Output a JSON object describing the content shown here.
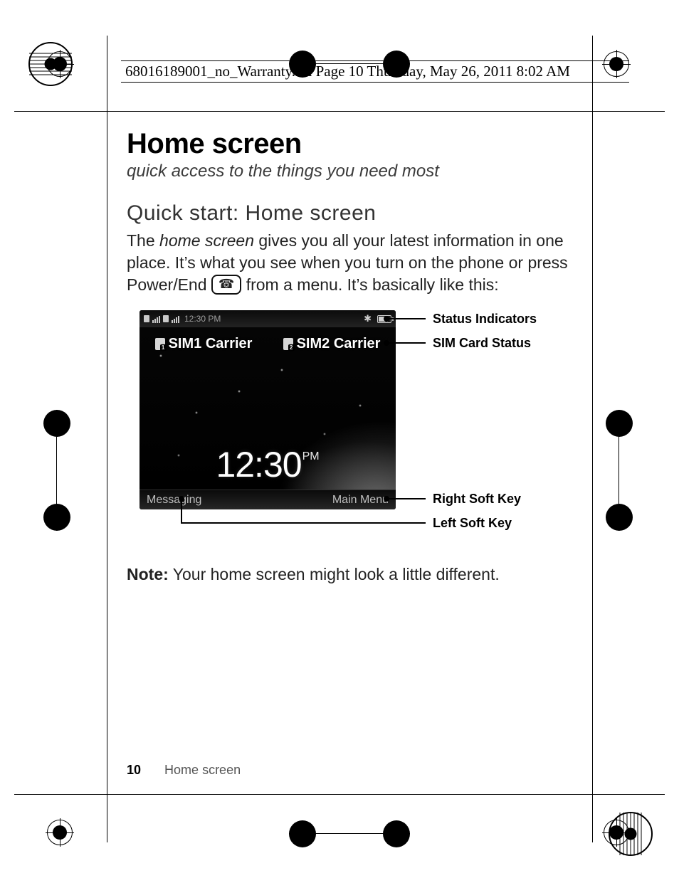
{
  "page_header": "68016189001_no_Warranty.fm  Page 10  Thursday, May 26, 2011  8:02 AM",
  "heading": "Home screen",
  "tagline": "quick access to the things you need most",
  "subheading": "Quick start: Home screen",
  "para1_a": "The ",
  "para1_b": "home screen",
  "para1_c": " gives you all your latest information in one place. It’s what you see when you turn on the phone or press Power/End ",
  "para1_d": " from a menu. It’s basically like this:",
  "power_key_glyph": "☎",
  "note_label": "Note:",
  "note_text": " Your home screen might look a little different.",
  "footer_page": "10",
  "footer_section": "Home screen",
  "device": {
    "status_time": "12:30 PM",
    "sim1": "SIM1 Carrier",
    "sim2": "SIM2 Carrier",
    "clock_time": "12:30",
    "clock_ampm": "PM",
    "left_soft": "Messaging",
    "right_soft": "Main Menu"
  },
  "callouts": {
    "status": "Status Indicators",
    "sim": "SIM Card Status",
    "right_soft": "Right Soft Key",
    "left_soft": "Left Soft Key"
  }
}
